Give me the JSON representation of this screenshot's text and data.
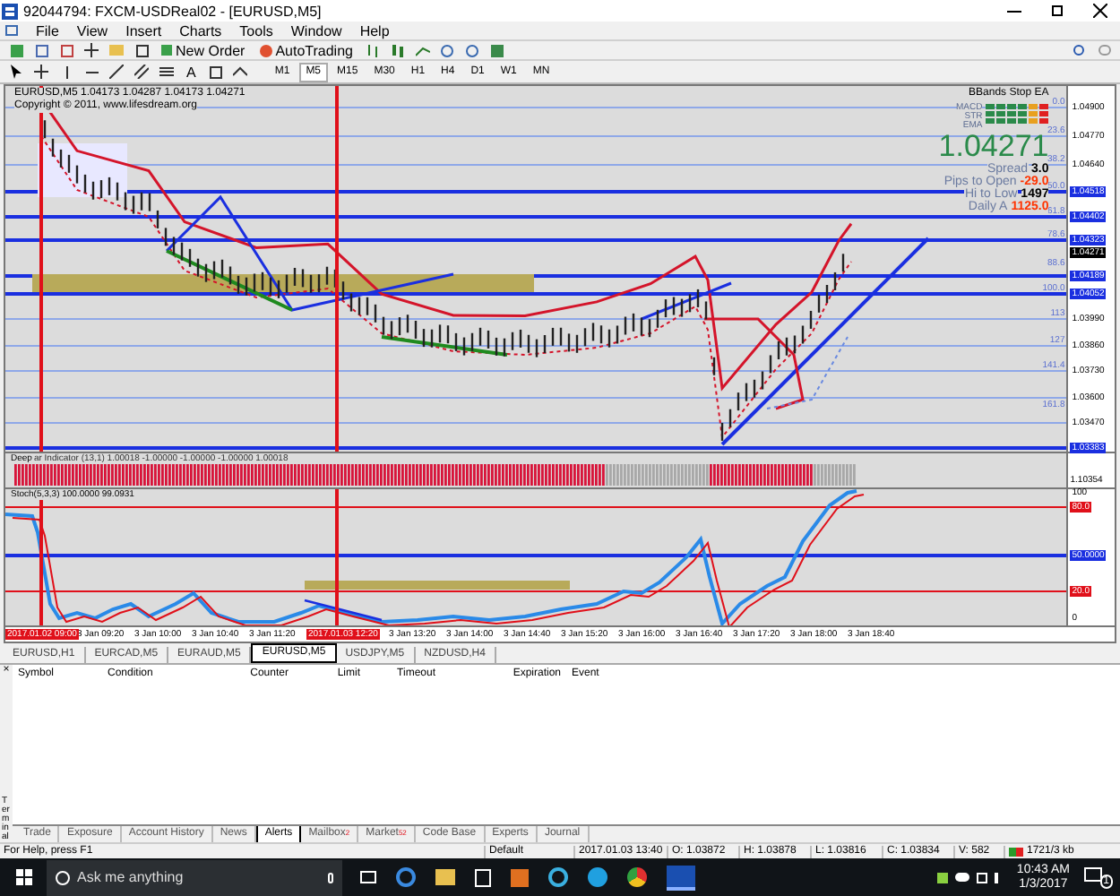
{
  "window": {
    "title": "92044794: FXCM-USDReal02 - [EURUSD,M5]"
  },
  "menu": [
    "File",
    "View",
    "Insert",
    "Charts",
    "Tools",
    "Window",
    "Help"
  ],
  "toolbar": {
    "buttons": [
      "New Order",
      "AutoTrading"
    ]
  },
  "drawing_tools": {
    "text_tool": "A"
  },
  "timeframes": [
    {
      "label": "M1",
      "selected": false
    },
    {
      "label": "M5",
      "selected": true
    },
    {
      "label": "M15",
      "selected": false
    },
    {
      "label": "M30",
      "selected": false
    },
    {
      "label": "H1",
      "selected": false
    },
    {
      "label": "H4",
      "selected": false
    },
    {
      "label": "D1",
      "selected": false
    },
    {
      "label": "W1",
      "selected": false
    },
    {
      "label": "MN",
      "selected": false
    }
  ],
  "chart": {
    "header": "EURUSD,M5  1.04173 1.04287 1.04173 1.04271",
    "copyright": "Copyright © 2011, www.lifesdream.org",
    "ea_name": "BBands Stop EA",
    "signal_labels": [
      "MACD",
      "STR",
      "EMA"
    ],
    "price": "1.04271",
    "stats": [
      {
        "label": "Spread",
        "value": "3.0",
        "color": "#000000"
      },
      {
        "label": "Pips to Open",
        "value": "-29.0",
        "color": "#ff3300"
      },
      {
        "label": "Hi to Low",
        "value": "1497",
        "color": "#000000"
      },
      {
        "label": "Daily A",
        "value": "1125.0",
        "color": "#ff3300"
      }
    ],
    "fib_levels": [
      "0.0",
      "23.6",
      "38.2",
      "50.0",
      "61.8",
      "78.6",
      "88.6",
      "100.0",
      "113",
      "127",
      "141.4",
      "161.8"
    ],
    "price_axis": [
      {
        "text": "1.04900",
        "kind": "plain"
      },
      {
        "text": "1.04770",
        "kind": "plain"
      },
      {
        "text": "1.04640",
        "kind": "plain"
      },
      {
        "text": "1.04518",
        "kind": "line"
      },
      {
        "text": "1.04402",
        "kind": "line"
      },
      {
        "text": "1.04323",
        "kind": "line"
      },
      {
        "text": "1.04271",
        "kind": "current"
      },
      {
        "text": "1.04189",
        "kind": "line"
      },
      {
        "text": "1.04052",
        "kind": "line"
      },
      {
        "text": "1.03990",
        "kind": "plain"
      },
      {
        "text": "1.03860",
        "kind": "plain"
      },
      {
        "text": "1.03730",
        "kind": "plain"
      },
      {
        "text": "1.03600",
        "kind": "plain"
      },
      {
        "text": "1.03470",
        "kind": "plain"
      },
      {
        "text": "1.03383",
        "kind": "line"
      }
    ]
  },
  "indicator": {
    "label_start": "Deep",
    "label_rest": "ar Indicator (13,1) 1.00018 -1.00000 -1.00000 -1.00000 1.00018",
    "axis": "1.10354"
  },
  "stochastic": {
    "label": "Stoch(5,3,3) 100.0000 99.0931",
    "axis": [
      {
        "text": "100",
        "kind": "plain"
      },
      {
        "text": "80.0",
        "kind": "red"
      },
      {
        "text": "50.0000",
        "kind": "blue"
      },
      {
        "text": "20.0",
        "kind": "red"
      },
      {
        "text": "0",
        "kind": "plain"
      }
    ]
  },
  "time_axis": {
    "markers": [
      "2017.01.02 09:00",
      "2017.01.03 12:20"
    ],
    "labels": [
      "3 Jan 09:20",
      "3 Jan 10:00",
      "3 Jan 10:40",
      "3 Jan 11:20",
      "3 Jan 13:20",
      "3 Jan 14:00",
      "3 Jan 14:40",
      "3 Jan 15:20",
      "3 Jan 16:00",
      "3 Jan 16:40",
      "3 Jan 17:20",
      "3 Jan 18:00",
      "3 Jan 18:40"
    ]
  },
  "chart_tabs": [
    {
      "label": "EURUSD,H1",
      "selected": false
    },
    {
      "label": "EURCAD,M5",
      "selected": false
    },
    {
      "label": "EURAUD,M5",
      "selected": false
    },
    {
      "label": "EURUSD,M5",
      "selected": true
    },
    {
      "label": "USDJPY,M5",
      "selected": false
    },
    {
      "label": "NZDUSD,H4",
      "selected": false
    }
  ],
  "terminal": {
    "close": "×",
    "title": "Terminal",
    "columns": [
      "Symbol",
      "Condition",
      "Counter",
      "Limit",
      "Timeout",
      "Expiration",
      "Event"
    ],
    "tabs": [
      {
        "label": "Trade",
        "selected": false
      },
      {
        "label": "Exposure",
        "selected": false
      },
      {
        "label": "Account History",
        "selected": false
      },
      {
        "label": "News",
        "selected": false
      },
      {
        "label": "Alerts",
        "selected": true
      },
      {
        "label": "Mailbox",
        "badge": "2",
        "selected": false
      },
      {
        "label": "Market",
        "badge": "52",
        "selected": false
      },
      {
        "label": "Code Base",
        "selected": false
      },
      {
        "label": "Experts",
        "selected": false
      },
      {
        "label": "Journal",
        "selected": false
      }
    ]
  },
  "status_bar": {
    "help": "For Help, press F1",
    "profile": "Default",
    "time": "2017.01.03 13:40",
    "open": "O: 1.03872",
    "high": "H: 1.03878",
    "low": "L: 1.03816",
    "close": "C: 1.03834",
    "volume": "V: 582",
    "traffic": "1721/3 kb"
  },
  "taskbar": {
    "search_placeholder": "Ask me anything",
    "time": "10:43 AM",
    "date": "1/3/2017",
    "notifications": "1"
  }
}
